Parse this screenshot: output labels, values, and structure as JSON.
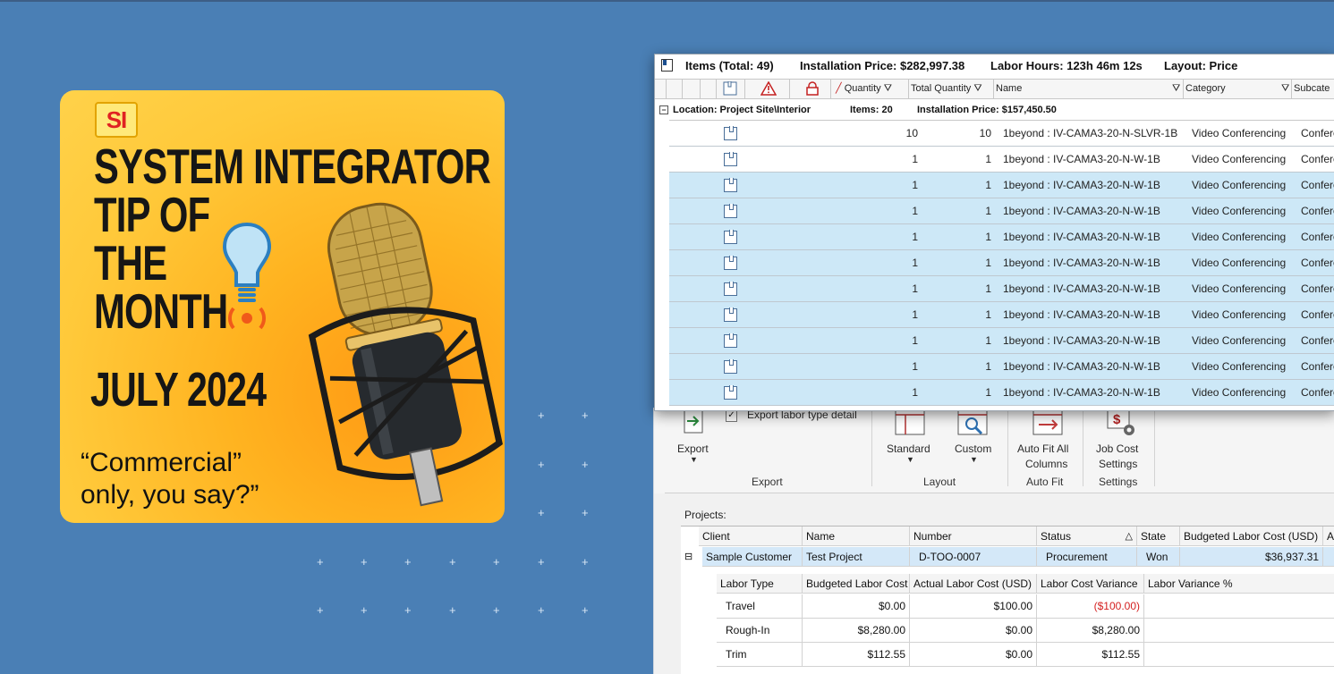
{
  "card": {
    "logo": "SI",
    "headline": [
      "SYSTEM INTEGRATOR",
      "TIP OF",
      "THE",
      "MONTH"
    ],
    "date": "JULY 2024",
    "quote_line1": "“Commercial”",
    "quote_line2": "only, you say?”"
  },
  "items_window": {
    "title": "Items (Total: 49)",
    "installation_price": "Installation Price: $282,997.38",
    "labor_hours": "Labor Hours: 123h 46m 12s",
    "layout": "Layout: Price",
    "columns": [
      "Quantity",
      "Total Quantity",
      "Name",
      "Category",
      "Subcate"
    ],
    "group": {
      "location": "Location: Project Site\\Interior",
      "items": "Items: 20",
      "installation_price": "Installation Price: $157,450.50"
    },
    "rows": [
      {
        "quantity": "10",
        "total_quantity": "10",
        "name": "1beyond : IV-CAMA3-20-N-SLVR-1B",
        "category": "Video Conferencing",
        "subcategory": "Confere"
      },
      {
        "quantity": "1",
        "total_quantity": "1",
        "name": "1beyond : IV-CAMA3-20-N-W-1B",
        "category": "Video Conferencing",
        "subcategory": "Confere"
      },
      {
        "quantity": "1",
        "total_quantity": "1",
        "name": "1beyond : IV-CAMA3-20-N-W-1B",
        "category": "Video Conferencing",
        "subcategory": "Confere"
      },
      {
        "quantity": "1",
        "total_quantity": "1",
        "name": "1beyond : IV-CAMA3-20-N-W-1B",
        "category": "Video Conferencing",
        "subcategory": "Confere"
      },
      {
        "quantity": "1",
        "total_quantity": "1",
        "name": "1beyond : IV-CAMA3-20-N-W-1B",
        "category": "Video Conferencing",
        "subcategory": "Confere"
      },
      {
        "quantity": "1",
        "total_quantity": "1",
        "name": "1beyond : IV-CAMA3-20-N-W-1B",
        "category": "Video Conferencing",
        "subcategory": "Confere"
      },
      {
        "quantity": "1",
        "total_quantity": "1",
        "name": "1beyond : IV-CAMA3-20-N-W-1B",
        "category": "Video Conferencing",
        "subcategory": "Confere"
      },
      {
        "quantity": "1",
        "total_quantity": "1",
        "name": "1beyond : IV-CAMA3-20-N-W-1B",
        "category": "Video Conferencing",
        "subcategory": "Confere"
      },
      {
        "quantity": "1",
        "total_quantity": "1",
        "name": "1beyond : IV-CAMA3-20-N-W-1B",
        "category": "Video Conferencing",
        "subcategory": "Confere"
      },
      {
        "quantity": "1",
        "total_quantity": "1",
        "name": "1beyond : IV-CAMA3-20-N-W-1B",
        "category": "Video Conferencing",
        "subcategory": "Confere"
      },
      {
        "quantity": "1",
        "total_quantity": "1",
        "name": "1beyond : IV-CAMA3-20-N-W-1B",
        "category": "Video Conferencing",
        "subcategory": "Confere"
      }
    ]
  },
  "ribbon": {
    "export_labor_detail": "Export labor type detail",
    "export_button": "Export",
    "export_group": "Export",
    "standard_button": "Standard",
    "custom_button": "Custom",
    "layout_group": "Layout",
    "autofit_line1": "Auto Fit All",
    "autofit_line2": "Columns",
    "autofit_group": "Auto Fit",
    "jobcost_line1": "Job Cost",
    "jobcost_line2": "Settings",
    "settings_group": "Settings"
  },
  "projects": {
    "label": "Projects:",
    "headers": {
      "client": "Client",
      "name": "Name",
      "number": "Number",
      "status": "Status",
      "state": "State",
      "budgeted": "Budgeted Labor Cost (USD)",
      "more": "A"
    },
    "row": {
      "client": "Sample Customer",
      "name": "Test Project",
      "number": "D-TOO-0007",
      "status": "Procurement",
      "state": "Won",
      "budgeted": "$36,937.31"
    },
    "labor_headers": {
      "type": "Labor Type",
      "budgeted": "Budgeted Labor Cost",
      "actual": "Actual Labor Cost (USD)",
      "variance": "Labor Cost Variance",
      "variance_pct": "Labor Variance %"
    },
    "labor_rows": [
      {
        "type": "Travel",
        "budgeted": "$0.00",
        "actual": "$100.00",
        "variance": "($100.00)"
      },
      {
        "type": "Rough-In",
        "budgeted": "$8,280.00",
        "actual": "$0.00",
        "variance": "$8,280.00"
      },
      {
        "type": "Trim",
        "budgeted": "$112.55",
        "actual": "$0.00",
        "variance": "$112.55"
      }
    ]
  }
}
